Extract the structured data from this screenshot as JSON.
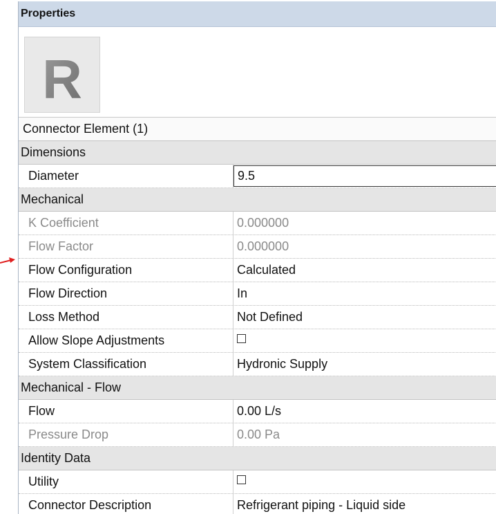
{
  "panel": {
    "title": "Properties"
  },
  "type_icon": {
    "letter": "R"
  },
  "selector": {
    "label": "Connector Element (1)"
  },
  "groups": [
    {
      "label": "Dimensions",
      "rows": [
        {
          "name": "Diameter",
          "value": "9.5",
          "disabled": false,
          "editing": true
        }
      ]
    },
    {
      "label": "Mechanical",
      "rows": [
        {
          "name": "K Coefficient",
          "value": "0.000000",
          "disabled": true
        },
        {
          "name": "Flow Factor",
          "value": "0.000000",
          "disabled": true
        },
        {
          "name": "Flow Configuration",
          "value": "Calculated",
          "disabled": false
        },
        {
          "name": "Flow Direction",
          "value": "In",
          "disabled": false
        },
        {
          "name": "Loss Method",
          "value": "Not Defined",
          "disabled": false
        },
        {
          "name": "Allow Slope Adjustments",
          "value": null,
          "checkbox": true,
          "checked": false,
          "disabled": false
        },
        {
          "name": "System Classification",
          "value": "Hydronic Supply",
          "disabled": false
        }
      ]
    },
    {
      "label": "Mechanical - Flow",
      "rows": [
        {
          "name": "Flow",
          "value": "0.00 L/s",
          "disabled": false
        },
        {
          "name": "Pressure Drop",
          "value": "0.00 Pa",
          "disabled": true
        }
      ]
    },
    {
      "label": "Identity Data",
      "rows": [
        {
          "name": "Utility",
          "value": null,
          "checkbox": true,
          "checked": false,
          "disabled": false
        },
        {
          "name": "Connector Description",
          "value": "Refrigerant piping - Liquid side",
          "disabled": false
        }
      ]
    }
  ],
  "colors": {
    "title_bar": "#cdd9e8",
    "group_bg": "#e5e5e5",
    "arrow": "#e02020",
    "disabled_text": "#8a8a8a"
  },
  "annotation": {
    "arrow_icon": "red-arrow-icon",
    "points_to": "Flow Configuration"
  }
}
